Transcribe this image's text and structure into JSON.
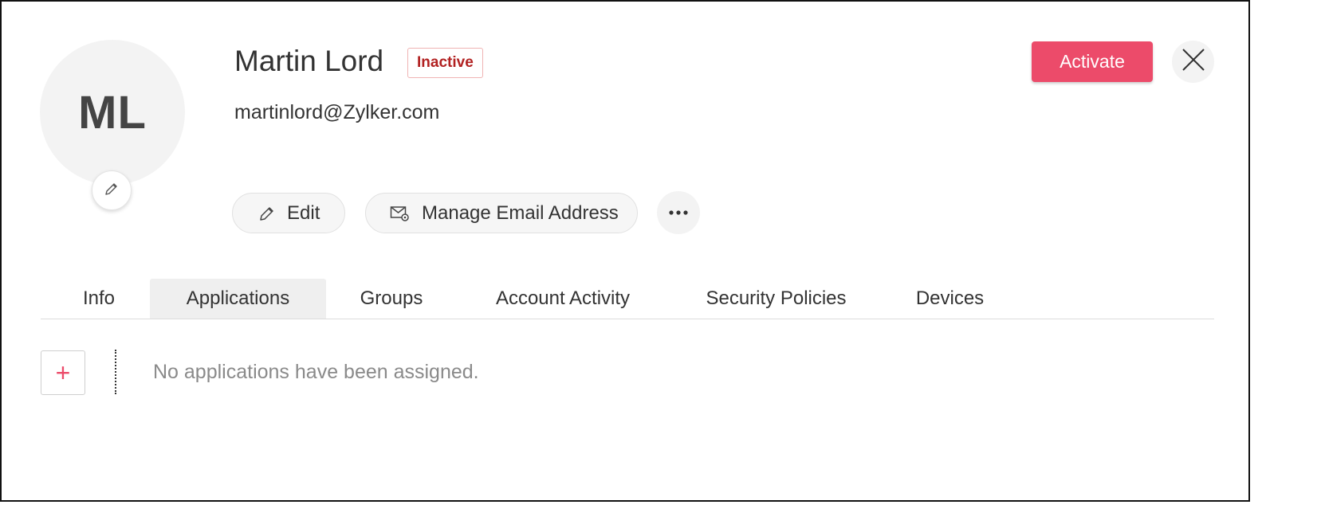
{
  "user": {
    "initials": "ML",
    "name": "Martin Lord",
    "status": "Inactive",
    "email": "martinlord@Zylker.com"
  },
  "actions": {
    "activate_label": "Activate",
    "edit_label": "Edit",
    "manage_email_label": "Manage Email Address"
  },
  "tabs": [
    {
      "label": "Info",
      "active": false
    },
    {
      "label": "Applications",
      "active": true
    },
    {
      "label": "Groups",
      "active": false
    },
    {
      "label": "Account Activity",
      "active": false
    },
    {
      "label": "Security Policies",
      "active": false
    },
    {
      "label": "Devices",
      "active": false
    }
  ],
  "applications": {
    "add_label": "+",
    "empty_message": "No applications have been assigned."
  },
  "icons": {
    "avatar_edit": "pencil-icon",
    "edit": "pencil-icon",
    "manage_email": "mail-settings-icon",
    "more": "more-horizontal-icon",
    "close": "close-icon"
  },
  "colors": {
    "accent": "#ec4b6a",
    "status_inactive": "#b22222",
    "status_border": "#f0b3b3"
  }
}
